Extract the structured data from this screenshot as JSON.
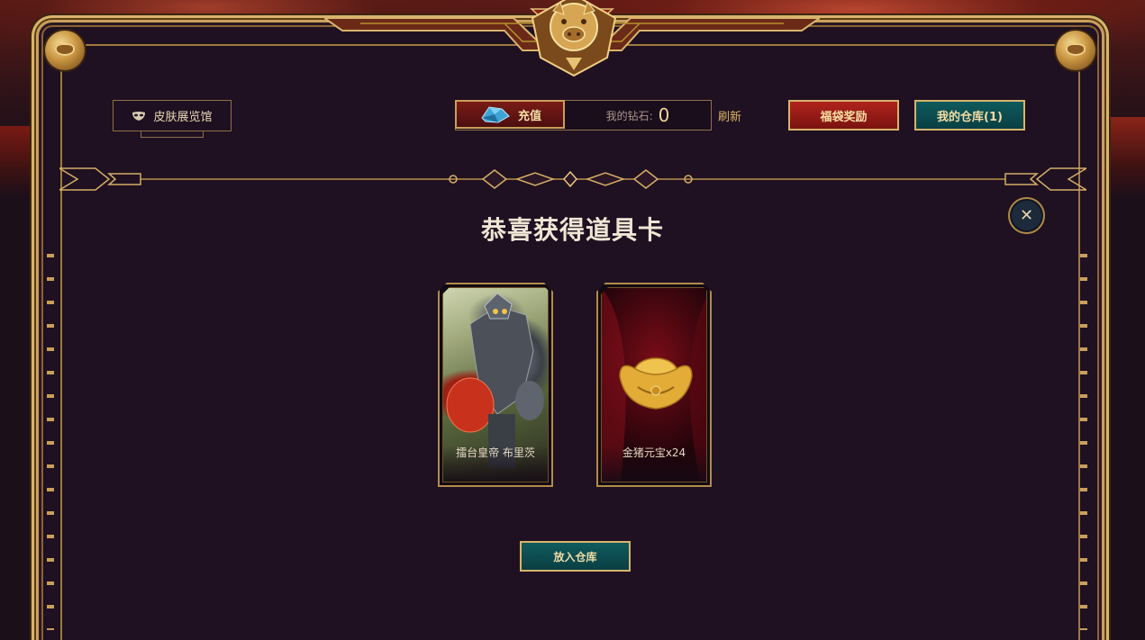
{
  "header": {
    "gallery_label": "皮肤展览馆",
    "recharge_label": "充值",
    "diamond_label": "我的钻石:",
    "diamond_value": "0",
    "refresh_label": "刷新",
    "lucky_bag_label": "福袋奖励",
    "vault_label": "我的仓库(1)"
  },
  "dialog": {
    "title": "恭喜获得道具卡",
    "close_icon": "close-icon",
    "cards": [
      {
        "label": "擂台皇帝 布里茨",
        "art": "champion-skin-art"
      },
      {
        "label": "金猪元宝x24",
        "art": "gold-ingot-icon"
      }
    ],
    "store_label": "放入仓库"
  },
  "theme": {
    "gold": "#c9a05a",
    "panel_bg": "#1f1022",
    "red_button": "#b1231c",
    "teal_button": "#0e5a5c"
  }
}
